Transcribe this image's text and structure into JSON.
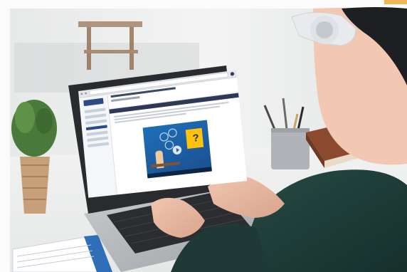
{
  "scene": {
    "subject": "person-with-headphones-using-laptop",
    "colors": {
      "wall": "#eef0ef",
      "desk": "#f2f3f2",
      "laptop_body": "#b9bcbf",
      "laptop_bezel": "#2a2b2e",
      "keyboard": "#2c2d30",
      "sweater": "#1f3a36",
      "skin": "#e8b8a0",
      "headphones": "#e9eaee",
      "plant": "#4a7a3b",
      "pot": "#c7a07a",
      "pencil_cup": "#b0b4b8",
      "book": "#8b4a2e",
      "accent_blue": "#1f6fb7",
      "accent_yellow": "#ffc20e"
    }
  },
  "screen": {
    "icons": [
      "play-icon",
      "question-mark-icon"
    ],
    "question_mark": "?"
  }
}
